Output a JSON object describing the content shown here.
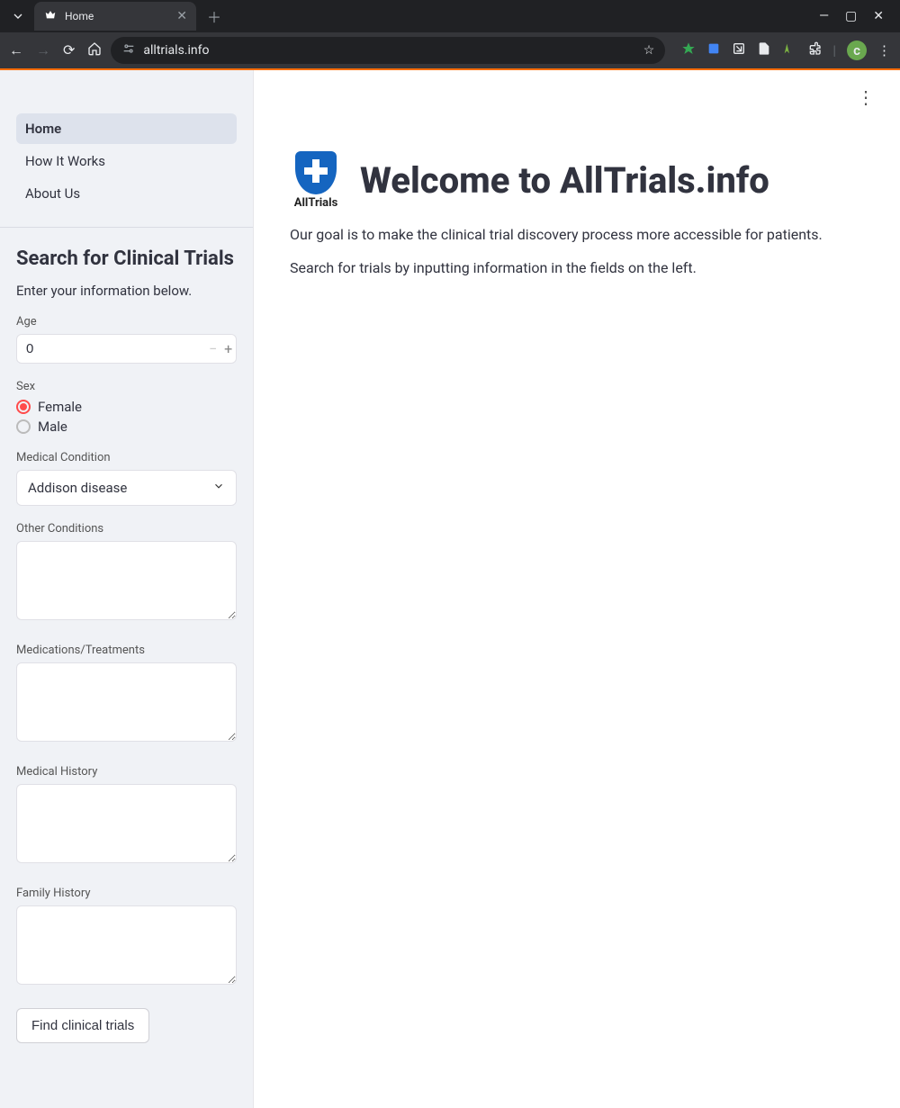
{
  "browser": {
    "tab_title": "Home",
    "url": "alltrials.info"
  },
  "sidebar": {
    "nav": [
      {
        "label": "Home",
        "active": true
      },
      {
        "label": "How It Works",
        "active": false
      },
      {
        "label": "About Us",
        "active": false
      }
    ],
    "search_heading": "Search for Clinical Trials",
    "search_sub": "Enter your information below.",
    "age_label": "Age",
    "age_value": "0",
    "sex_label": "Sex",
    "sex_options": [
      "Female",
      "Male"
    ],
    "sex_selected": "Female",
    "condition_label": "Medical Condition",
    "condition_value": "Addison disease",
    "other_conditions_label": "Other Conditions",
    "medications_label": "Medications/Treatments",
    "medical_history_label": "Medical History",
    "family_history_label": "Family History",
    "submit_label": "Find clinical trials"
  },
  "main": {
    "logo_caption": "AllTrials",
    "title": "Welcome to AllTrials.info",
    "p1": "Our goal is to make the clinical trial discovery process more accessible for patients.",
    "p2": "Search for trials by inputting information in the fields on the left."
  }
}
